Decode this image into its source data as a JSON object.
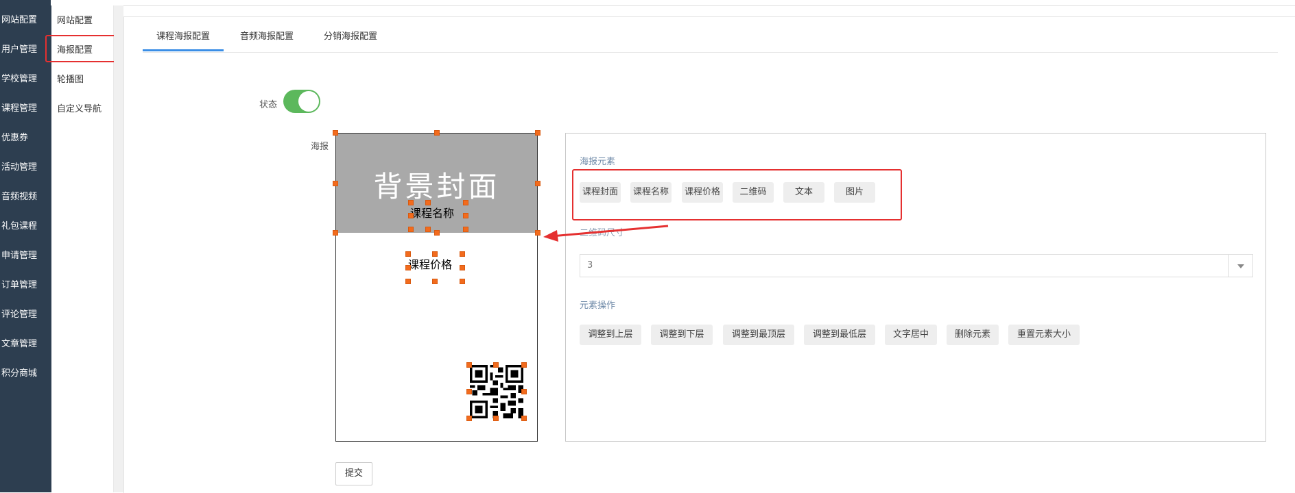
{
  "sidebar": {
    "items": [
      {
        "label": "网站配置"
      },
      {
        "label": "用户管理"
      },
      {
        "label": "学校管理"
      },
      {
        "label": "课程管理"
      },
      {
        "label": "优惠券"
      },
      {
        "label": "活动管理"
      },
      {
        "label": "音频视频"
      },
      {
        "label": "礼包课程"
      },
      {
        "label": "申请管理"
      },
      {
        "label": "订单管理"
      },
      {
        "label": "评论管理"
      },
      {
        "label": "文章管理"
      },
      {
        "label": "积分商城"
      }
    ]
  },
  "subnav": {
    "items": [
      {
        "label": "网站配置"
      },
      {
        "label": "海报配置"
      },
      {
        "label": "轮播图"
      },
      {
        "label": "自定义导航"
      }
    ],
    "active": "海报配置"
  },
  "tabs": [
    {
      "label": "课程海报配置",
      "active": true
    },
    {
      "label": "音频海报配置",
      "active": false
    },
    {
      "label": "分销海报配置",
      "active": false
    }
  ],
  "form": {
    "status_label": "状态",
    "status_on": true,
    "poster_label": "海报",
    "submit_label": "提交"
  },
  "poster": {
    "background_text": "背景封面",
    "course_name": "课程名称",
    "course_price": "课程价格",
    "qr_icon": "qr-code-icon"
  },
  "props": {
    "elements_title": "海报元素",
    "elements": [
      "课程封面",
      "课程名称",
      "课程价格",
      "二维码",
      "文本",
      "图片"
    ],
    "qr_size_label": "二维码尺寸",
    "qr_size_value": "3",
    "ops_title": "元素操作",
    "ops": [
      "调整到上层",
      "调整到下层",
      "调整到最顶层",
      "调整到最低层",
      "文字居中",
      "删除元素",
      "重置元素大小"
    ]
  },
  "colors": {
    "sidebar_bg": "#2d3e50",
    "accent": "#3a8ee6",
    "toggle_on": "#5cb85c",
    "annotation": "#e53030",
    "handle": "#f26b1d",
    "cover_bg": "#a9a9a9"
  }
}
